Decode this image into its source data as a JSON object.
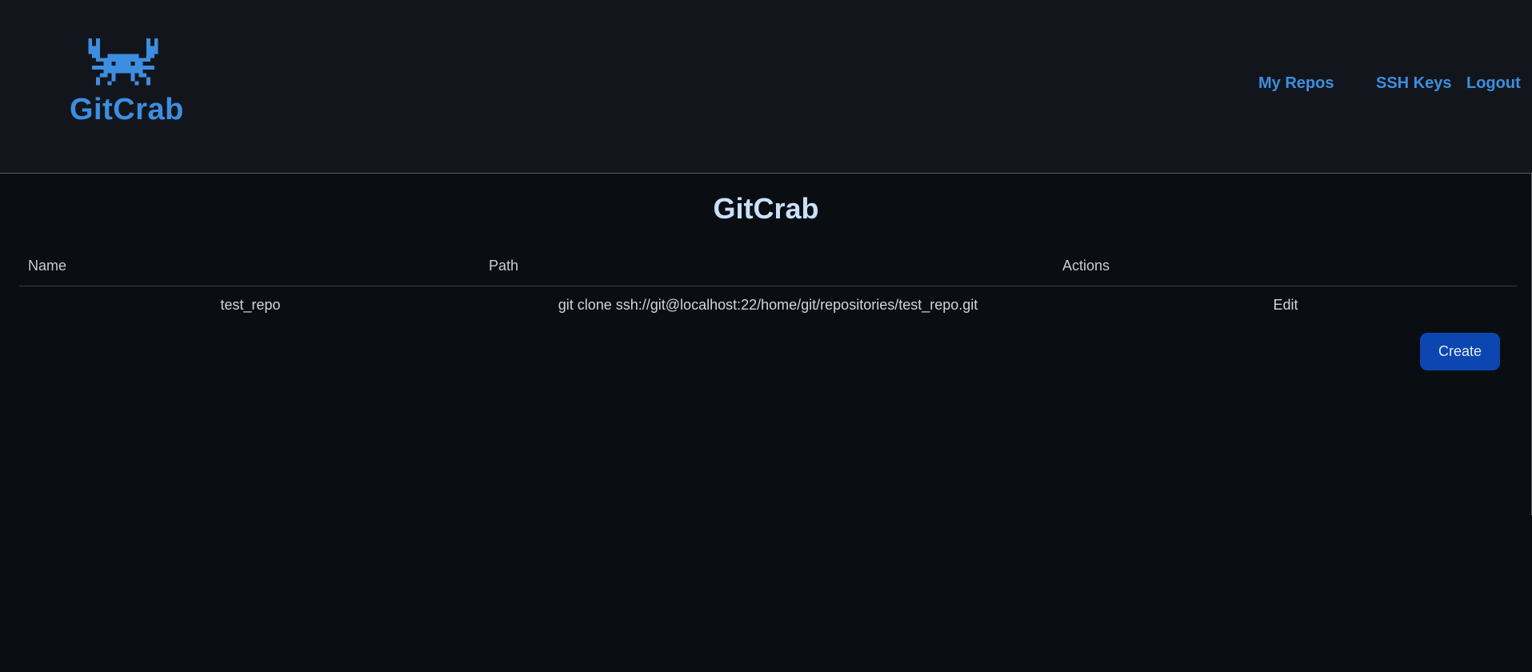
{
  "header": {
    "logo_text": "GitCrab",
    "logo_icon": "crab-icon",
    "nav": [
      {
        "label": "My Repos"
      },
      {
        "label": "SSH Keys"
      },
      {
        "label": "Logout"
      }
    ]
  },
  "main": {
    "title": "GitCrab",
    "table": {
      "columns": [
        "Name",
        "Path",
        "Actions"
      ],
      "rows": [
        {
          "name": "test_repo",
          "path": "git clone ssh://git@localhost:22/home/git/repositories/test_repo.git",
          "action": "Edit"
        }
      ]
    },
    "create_label": "Create"
  },
  "colors": {
    "accent": "#3d8ee0",
    "header_bg": "#12161c",
    "page_bg": "#0a0d12",
    "button_bg": "#0c46b0",
    "title": "#c8e1fb"
  }
}
